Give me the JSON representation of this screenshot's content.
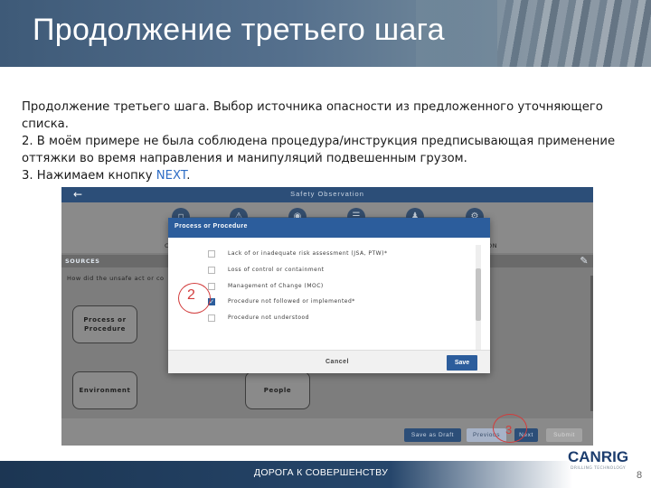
{
  "slide": {
    "title": "Продолжение третьего шага",
    "body": {
      "line1": "Продолжение третьего шага. Выбор источника опасности из предложенного уточняющего",
      "line2": "списка.",
      "line3": "2. В моём примере не была соблюдена процедура/инструкция предписывающая применение",
      "line4": "оттяжки во время направления и манипуляций подвешенным грузом.",
      "line5_prefix": "3. Нажимаем кнопку ",
      "line5_next": "NEXT",
      "line5_suffix": "."
    },
    "footer": "ДОРОГА К СОВЕРШЕНСТВУ",
    "page_number": "8",
    "logo": {
      "name": "CANRIG",
      "tagline": "DRILLING TECHNOLOGY"
    }
  },
  "app": {
    "back_icon": "arrow-left-icon",
    "title": "Safety Observation",
    "steps": {
      "step1_label": "C",
      "step6_label": "ON"
    },
    "sources_header": "SOURCES",
    "question": "How did the unsafe act or co",
    "categories": {
      "process": "Process or Procedure",
      "environment": "Environment",
      "people": "People"
    },
    "footer": {
      "save_draft": "Save as Draft",
      "previous": "Previous",
      "next": "Next",
      "submit": "Submit"
    }
  },
  "modal": {
    "title": "Process or Procedure",
    "options": [
      {
        "label": "Lack of or inadequate risk assessment (JSA, PTW)*",
        "checked": false
      },
      {
        "label": "Loss of control or containment",
        "checked": false
      },
      {
        "label": "Management of Change (MOC)",
        "checked": false
      },
      {
        "label": "Procedure not followed or implemented*",
        "checked": true
      },
      {
        "label": "Procedure not understood",
        "checked": false
      }
    ],
    "cancel": "Cancel",
    "save": "Save"
  },
  "annotations": {
    "circle_2": "2",
    "circle_3": "3"
  },
  "colors": {
    "accent_blue": "#2c5d9c",
    "annotation_red": "#d23c3c",
    "link_blue": "#2e6dc5"
  }
}
